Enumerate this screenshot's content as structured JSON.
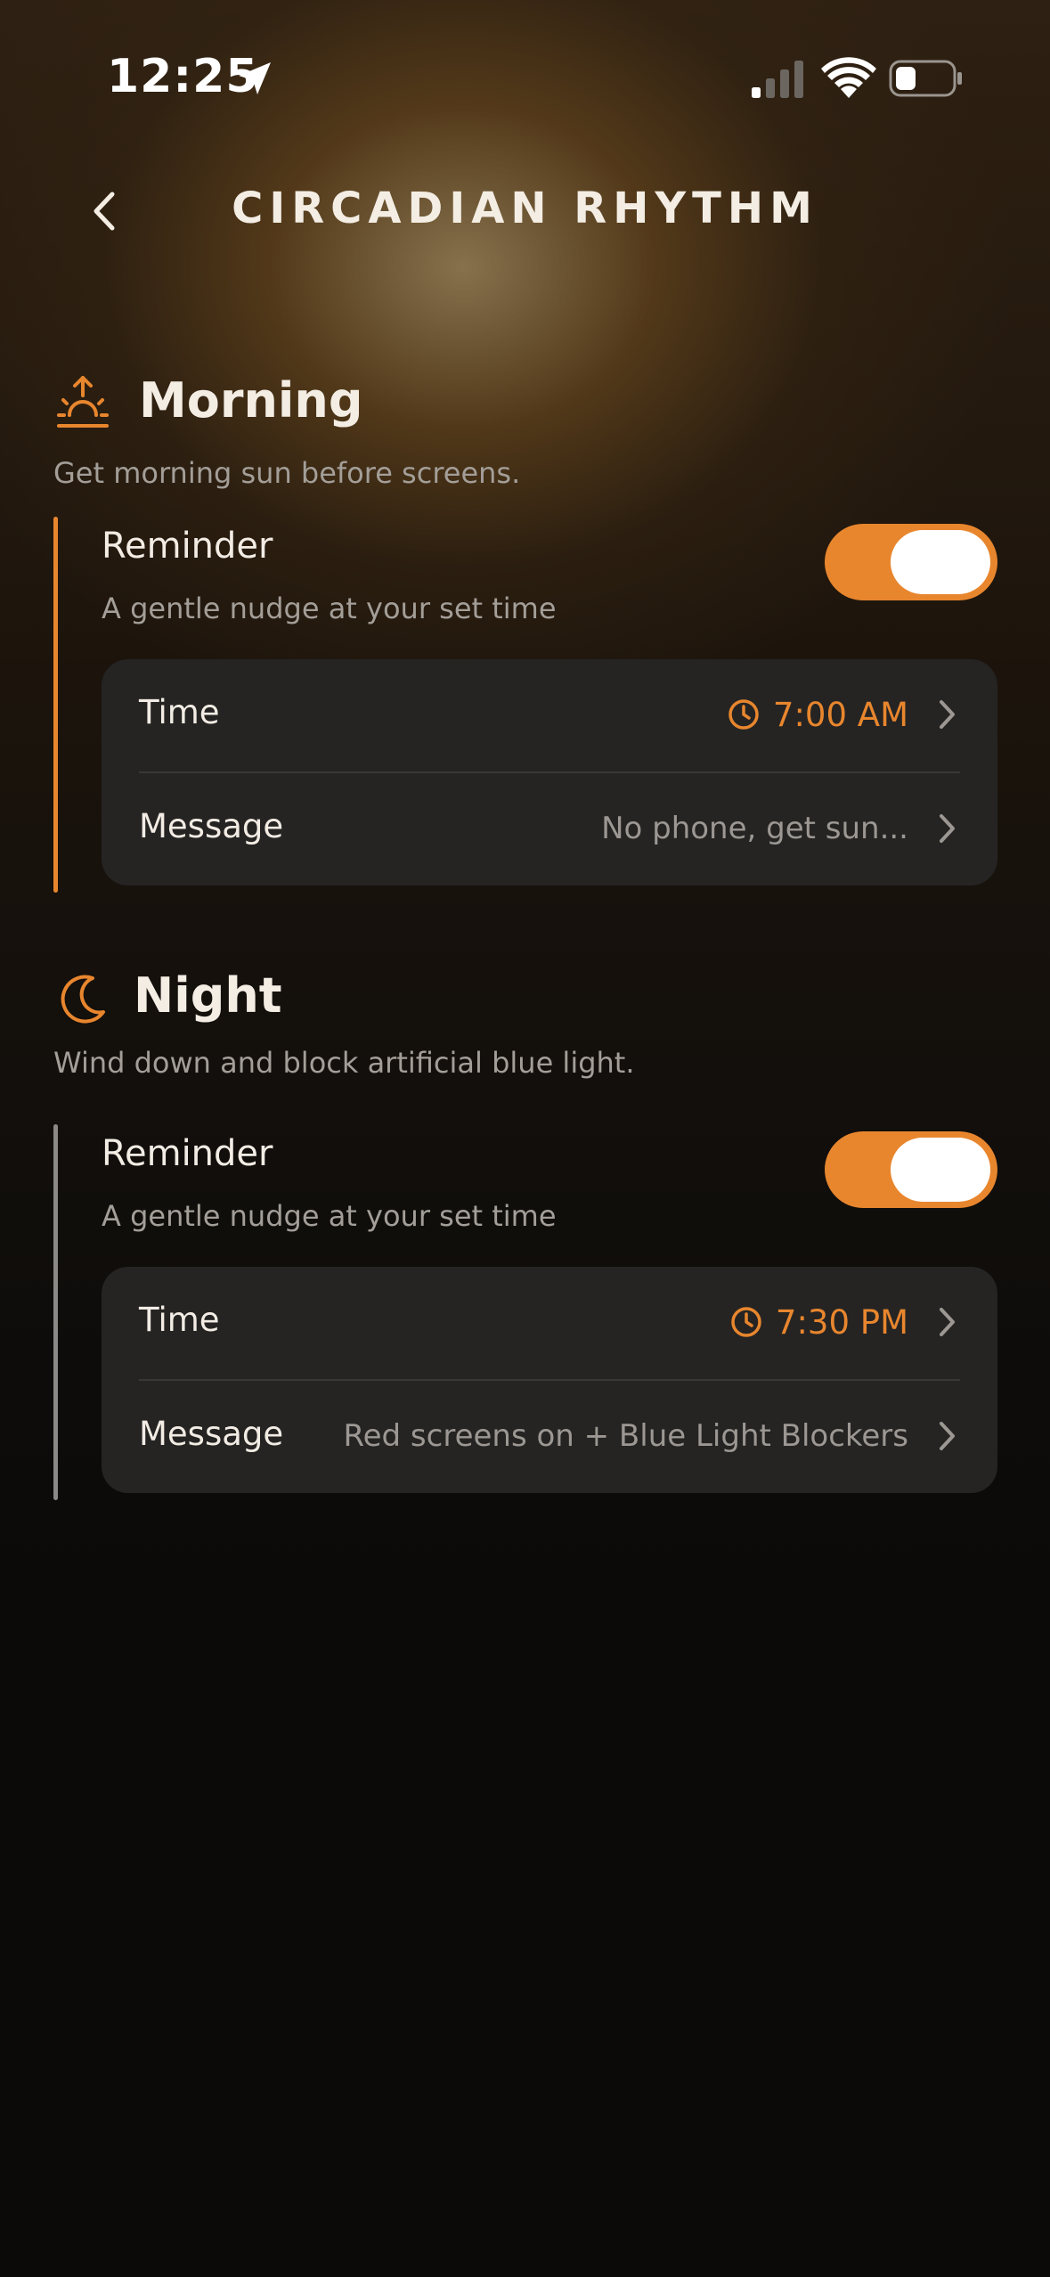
{
  "status_bar": {
    "time": "12:25"
  },
  "header": {
    "title": "CIRCADIAN RHYTHM"
  },
  "colors": {
    "accent": "#e8862e",
    "card": "#252423",
    "neutral_bar": "#8b8986"
  },
  "sections": [
    {
      "title": "Morning",
      "icon": "sunrise-icon",
      "description": "Get morning sun before screens.",
      "reminder": {
        "title": "Reminder",
        "subtitle": "A gentle nudge at your set time",
        "enabled": true
      },
      "rows": [
        {
          "label": "Time",
          "value": "7:00 AM",
          "icon": "clock-icon"
        },
        {
          "label": "Message",
          "value": "No phone, get sun..."
        }
      ]
    },
    {
      "title": "Night",
      "icon": "moon-icon",
      "description": "Wind down and block artificial blue light.",
      "reminder": {
        "title": "Reminder",
        "subtitle": "A gentle nudge at your set time",
        "enabled": true
      },
      "rows": [
        {
          "label": "Time",
          "value": "7:30 PM",
          "icon": "clock-icon"
        },
        {
          "label": "Message",
          "value": "Red screens on + Blue Light Blockers"
        }
      ]
    }
  ]
}
